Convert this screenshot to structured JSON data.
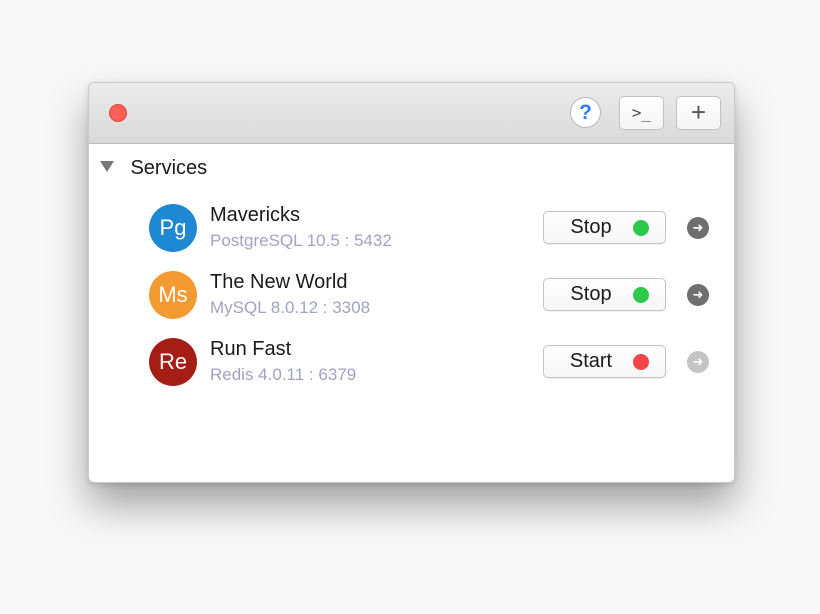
{
  "toolbar": {
    "help_label": "?",
    "terminal_label": ">_",
    "add_label": "+"
  },
  "section": {
    "title": "Services"
  },
  "services": [
    {
      "avatar": "Pg",
      "avatar_color": "#1e88d2",
      "name": "Mavericks",
      "detail": "PostgreSQL 10.5 : 5432",
      "action": "Stop",
      "status_color": "#2ec94a",
      "arrow_color": "#6f6f6f"
    },
    {
      "avatar": "Ms",
      "avatar_color": "#f39a32",
      "name": "The New World",
      "detail": "MySQL 8.0.12 : 3308",
      "action": "Stop",
      "status_color": "#2ec94a",
      "arrow_color": "#6f6f6f"
    },
    {
      "avatar": "Re",
      "avatar_color": "#a51e15",
      "name": "Run Fast",
      "detail": "Redis 4.0.11 : 6379",
      "action": "Start",
      "status_color": "#f04646",
      "arrow_color": "#c4c4c4"
    }
  ],
  "icons": {
    "close": "close-dot-icon",
    "help": "question-mark-icon",
    "terminal": "terminal-icon",
    "add": "plus-icon",
    "disclosure": "disclosure-triangle-icon",
    "go": "arrow-right-circle-icon"
  }
}
